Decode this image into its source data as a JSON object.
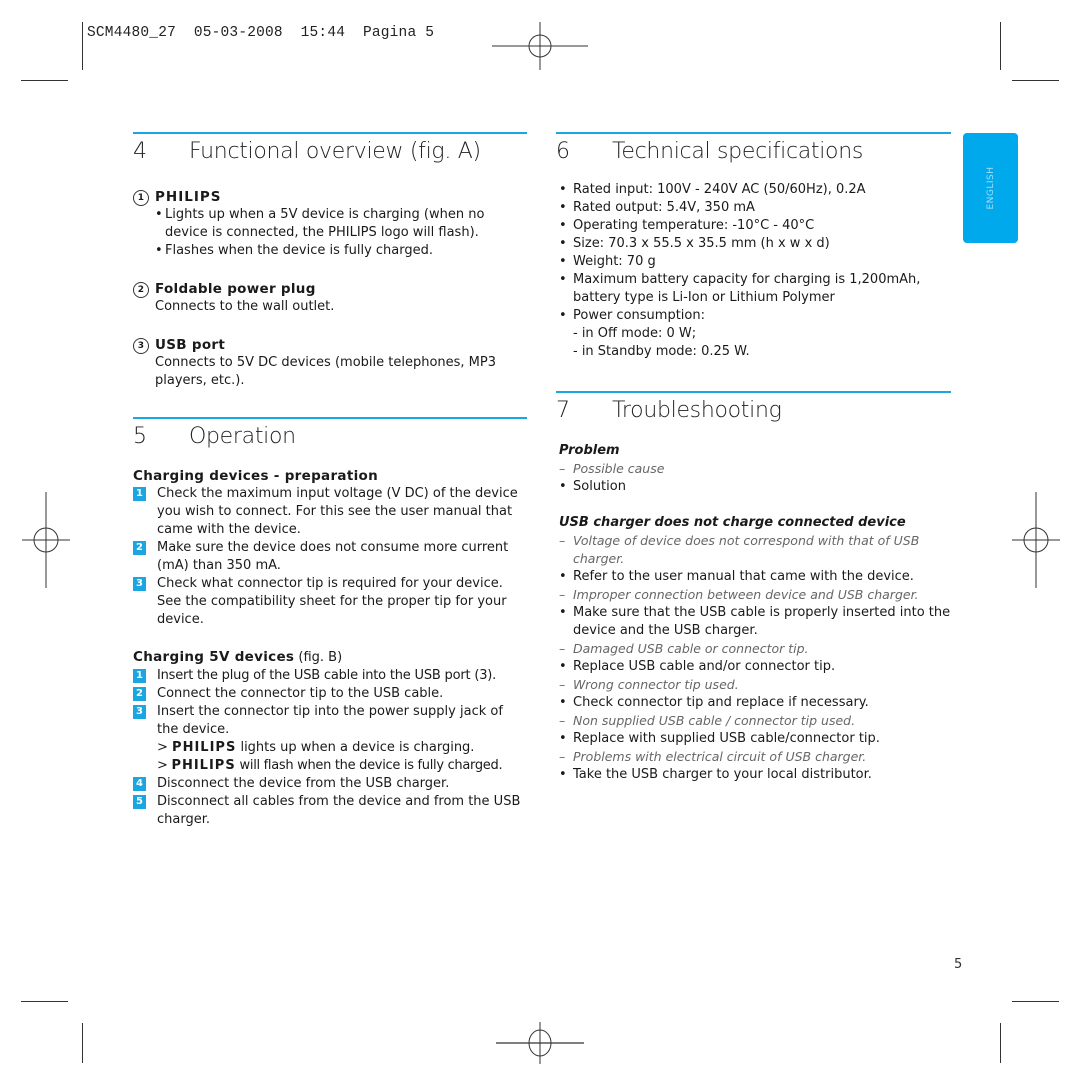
{
  "slug": {
    "text": "SCM4480_27  05-03-2008  15:44  Pagina 5"
  },
  "language_tab": {
    "label": "ENGLISH",
    "color": "#00a9ec"
  },
  "accent_color": "#1aa6e0",
  "page_number": "5",
  "section4": {
    "number": "4",
    "title": "Functional overview (fig. A)",
    "items": [
      {
        "marker": "1",
        "heading": "PHILIPS",
        "bullets": [
          "Lights up when a 5V device is charging (when no device is connected, the PHILIPS logo will flash).",
          "Flashes when the device is fully charged."
        ]
      },
      {
        "marker": "2",
        "heading": "Foldable power plug",
        "text": "Connects to the wall outlet."
      },
      {
        "marker": "3",
        "heading": "USB port",
        "text": "Connects to 5V DC devices (mobile telephones, MP3 players, etc.)."
      }
    ]
  },
  "section5": {
    "number": "5",
    "title": "Operation",
    "prep": {
      "heading": "Charging devices - preparation",
      "steps": [
        {
          "num": "1",
          "text": "Check the maximum input voltage (V DC) of the device you wish to connect. For this see the user manual that came with the device."
        },
        {
          "num": "2",
          "text": "Make sure the device does not consume more current (mA) than 350 mA."
        },
        {
          "num": "3",
          "text": "Check what connector tip is required for your device. See the compatibility sheet for the proper tip for your device."
        }
      ]
    },
    "charging": {
      "heading": "Charging 5V devices",
      "heading_suffix": "(fig. B)",
      "steps": [
        {
          "num": "1",
          "text": "Insert the plug of the USB cable into the USB port (3)."
        },
        {
          "num": "2",
          "text": "Connect the connector tip to the USB cable."
        },
        {
          "num": "3",
          "text": "Insert the connector tip into the power supply jack of the device."
        },
        {
          "num": "4",
          "text": "Disconnect the device from the USB charger."
        },
        {
          "num": "5",
          "text": "Disconnect all cables from the device and from the USB charger."
        }
      ],
      "results": [
        {
          "prefix": ">",
          "brand": "PHILIPS",
          "text": "lights up when a device is charging."
        },
        {
          "prefix": ">",
          "brand": "PHILIPS",
          "text": "will flash when the device is fully charged."
        }
      ]
    }
  },
  "section6": {
    "number": "6",
    "title": "Technical specifications",
    "bullets": [
      "Rated input: 100V - 240V AC (50/60Hz), 0.2A",
      "Rated output: 5.4V, 350 mA",
      "Operating temperature: -10°C - 40°C",
      "Size: 70.3 x 55.5 x 35.5 mm (h x w x d)",
      "Weight: 70 g",
      "Maximum battery capacity for charging is 1,200mAh, battery type is Li-Ion or Lithium Polymer",
      "Power consumption:"
    ],
    "power_lines": [
      "- in Off mode: 0 W;",
      "- in Standby mode: 0.25 W."
    ]
  },
  "section7": {
    "number": "7",
    "title": "Troubleshooting",
    "legend": {
      "problem": "Problem",
      "cause": "Possible cause",
      "solution": "Solution"
    },
    "problem_title": "USB charger does not charge connected device",
    "entries": [
      {
        "cause": "Voltage of device does not correspond with that of USB charger.",
        "solution": "Refer to the user manual that came with the device."
      },
      {
        "cause": "Improper connection between device and USB charger.",
        "solution": "Make sure that the USB cable is properly inserted into the device and the USB charger."
      },
      {
        "cause": "Damaged USB cable or connector tip.",
        "solution": "Replace USB cable and/or connector tip."
      },
      {
        "cause": "Wrong connector tip used.",
        "solution": "Check connector tip and replace if necessary."
      },
      {
        "cause": "Non supplied USB cable / connector tip used.",
        "solution": "Replace with supplied USB cable/connector tip."
      },
      {
        "cause": "Problems with electrical circuit of USB charger.",
        "solution": "Take the USB charger to your local distributor."
      }
    ]
  }
}
